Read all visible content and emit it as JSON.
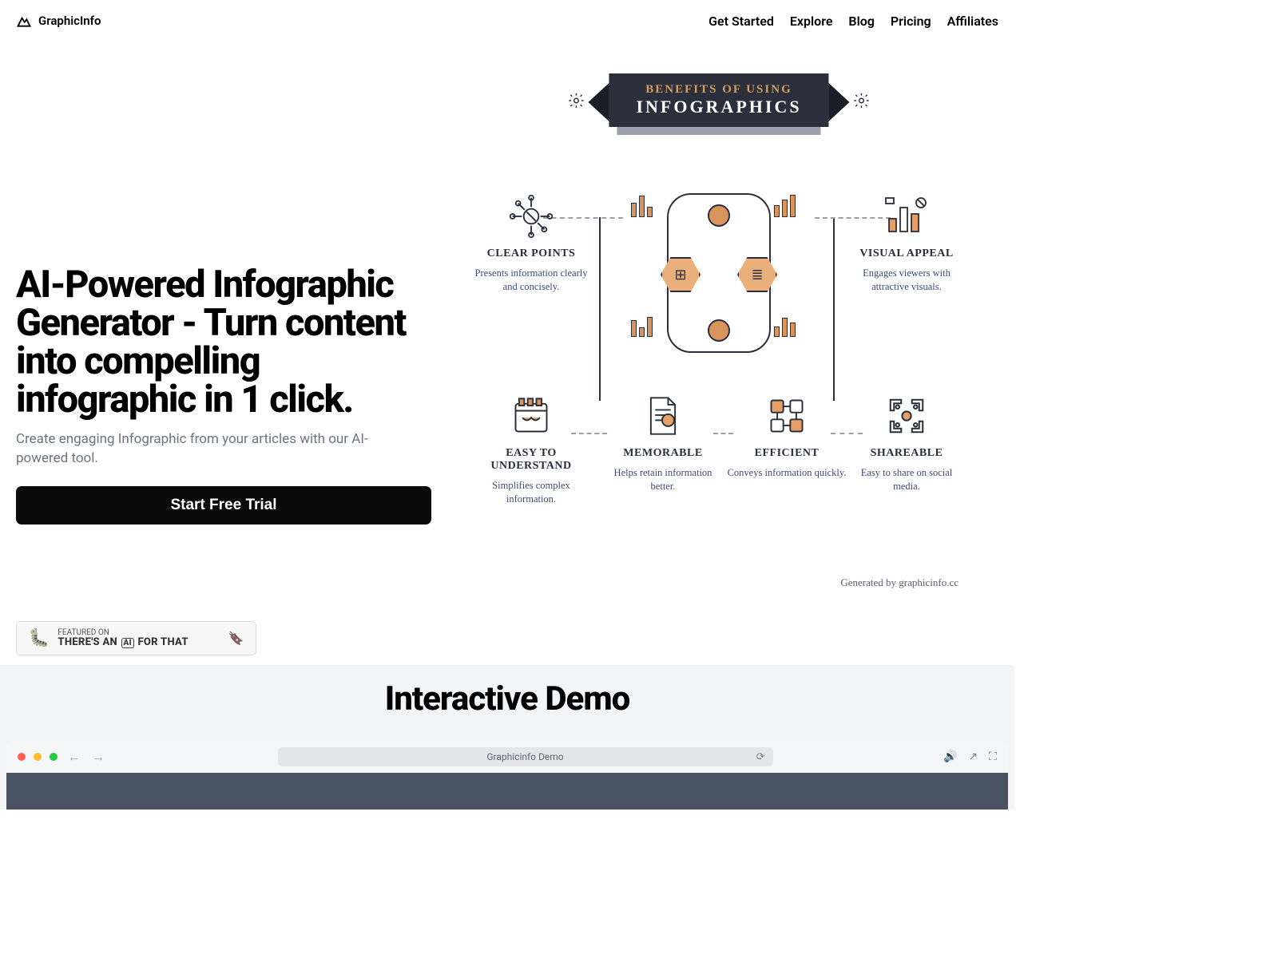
{
  "brand": "GraphicInfo",
  "nav": {
    "get_started": "Get Started",
    "explore": "Explore",
    "blog": "Blog",
    "pricing": "Pricing",
    "affiliates": "Affiliates"
  },
  "hero": {
    "title": "AI-Powered Infographic Generator - Turn content into compelling infographic in 1 click.",
    "subtitle": "Create engaging Infographic from your articles with our AI-powered tool.",
    "cta": "Start Free Trial"
  },
  "infographic": {
    "banner_line1": "BENEFITS OF USING",
    "banner_line2": "INFOGRAPHICS",
    "benefits": {
      "clear_points": {
        "title": "CLEAR POINTS",
        "desc": "Presents information clearly and concisely."
      },
      "visual_appeal": {
        "title": "VISUAL APPEAL",
        "desc": "Engages viewers with attractive visuals."
      },
      "easy_understand": {
        "title": "EASY TO UNDERSTAND",
        "desc": "Simplifies complex information."
      },
      "memorable": {
        "title": "MEMORABLE",
        "desc": "Helps retain information better."
      },
      "efficient": {
        "title": "EFFICIENT",
        "desc": "Conveys information quickly."
      },
      "shareable": {
        "title": "SHAREABLE",
        "desc": "Easy to share on social media."
      }
    },
    "generated_by": "Generated by graphicinfo.cc"
  },
  "featured": {
    "line1": "FEATURED ON",
    "line2_pre": "THERE'S AN",
    "line2_mid": "AI",
    "line2_post": "FOR THAT"
  },
  "demo": {
    "title": "Interactive Demo",
    "url_label": "Graphicinfo Demo"
  }
}
